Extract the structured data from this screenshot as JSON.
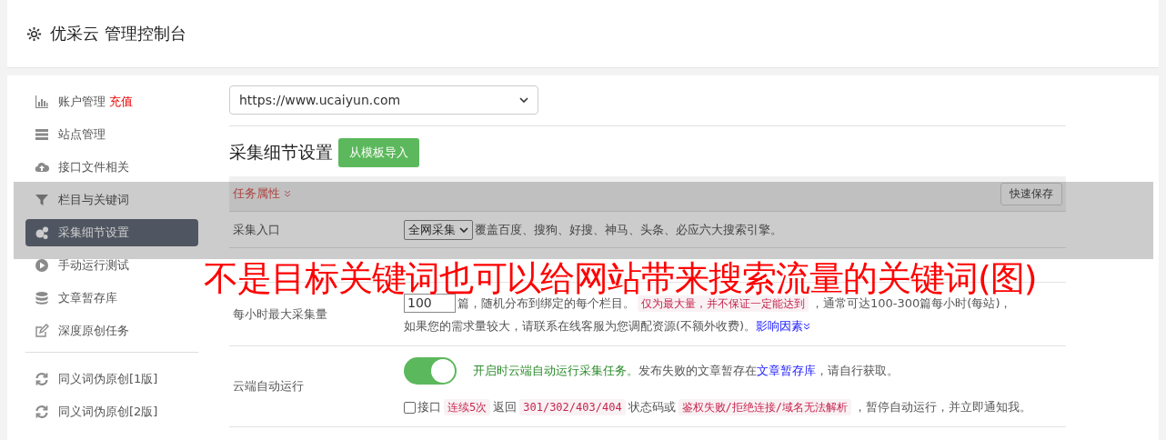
{
  "header": {
    "title": "优采云 管理控制台"
  },
  "sidebar": {
    "groups": [
      [
        {
          "label": "账户管理",
          "badge": "充值",
          "selected": false
        },
        {
          "label": "站点管理",
          "selected": false
        },
        {
          "label": "接口文件相关",
          "selected": false
        },
        {
          "label": "栏目与关键词",
          "selected": false
        },
        {
          "label": "采集细节设置",
          "selected": true
        },
        {
          "label": "手动运行测试",
          "selected": false
        },
        {
          "label": "文章暂存库",
          "selected": false
        },
        {
          "label": "深度原创任务",
          "selected": false
        }
      ],
      [
        {
          "label": "同义词伪原创[1版]",
          "selected": false
        },
        {
          "label": "同义词伪原创[2版]",
          "selected": false
        }
      ]
    ]
  },
  "site_select": {
    "value": "https://www.ucaiyun.com"
  },
  "section": {
    "title": "采集细节设置",
    "import_button": "从模板导入"
  },
  "panel": {
    "title": "任务属性",
    "save_button": "快速保存"
  },
  "rows": [
    {
      "kind": "select",
      "label": "采集入口",
      "value": "全网采集",
      "note": "覆盖百度、搜狗、好搜、神马、头条、必应六大搜索引擎。"
    },
    {
      "kind": "number",
      "label": "每小时最大采集量",
      "value": "100",
      "text": "篇，随机分布到绑定的每个栏目。",
      "tag": "仅为最大量，并不保证一定能达到",
      "after": "，通常可达100-300篇每小时(每站)，",
      "line2": "如果您的需求量较大，请联系在线客服为您调配资源(不额外收费)。",
      "link": "影响因素"
    },
    {
      "kind": "toggle",
      "label": "云端自动运行",
      "on": true,
      "note_green": "开启时云端自动运行采集任务。",
      "note": "发布失败的文章暂存在",
      "link": "文章暂存库",
      "after": "，请自行获取。",
      "check": {
        "checked": false,
        "parts": [
          {
            "kind": "text",
            "text": "接口"
          },
          {
            "kind": "code",
            "text": "连续5次"
          },
          {
            "kind": "text",
            "text": "返回"
          },
          {
            "kind": "code",
            "text": "301/302/403/404"
          },
          {
            "kind": "text",
            "text": "状态码或"
          },
          {
            "kind": "code",
            "text": "鉴权失败/拒绝连接/域名无法解析"
          },
          {
            "kind": "text",
            "text": "，暂停自动运行，并立即通知我。"
          }
        ]
      }
    }
  ],
  "overlay": {
    "title": "不是目标关键词也可以给网站带来搜索流量的关键词(图)"
  }
}
